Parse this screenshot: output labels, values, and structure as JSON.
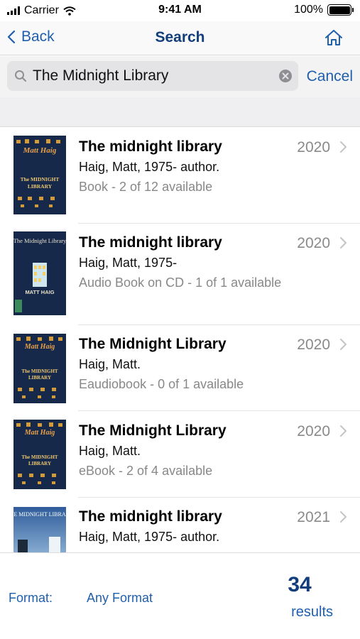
{
  "status_bar": {
    "carrier": "Carrier",
    "time": "9:41 AM",
    "battery": "100%"
  },
  "nav": {
    "back_label": "Back",
    "title": "Search"
  },
  "search": {
    "query": "The Midnight Library",
    "cancel_label": "Cancel"
  },
  "results": [
    {
      "title": "The midnight library",
      "author": "Haig, Matt, 1975- author.",
      "format": "Book - 2 of 12 available",
      "year": "2020",
      "cover": "dark"
    },
    {
      "title": "The midnight library",
      "author": "Haig, Matt, 1975-",
      "format": "Audio Book on CD - 1 of 1 available",
      "year": "2020",
      "cover": "cd"
    },
    {
      "title": "The Midnight Library",
      "author": "Haig, Matt.",
      "format": "Eaudiobook - 0 of 1 available",
      "year": "2020",
      "cover": "dark"
    },
    {
      "title": "The Midnight Library",
      "author": "Haig, Matt.",
      "format": "eBook - 2 of 4 available",
      "year": "2020",
      "cover": "dark"
    },
    {
      "title": "The midnight library",
      "author": "Haig, Matt, 1975- author.",
      "format": "",
      "year": "2021",
      "cover": "blue"
    }
  ],
  "footer": {
    "format_label": "Format:",
    "format_value": "Any Format",
    "count": "34",
    "count_label": "results"
  },
  "colors": {
    "accent": "#1f5fae",
    "title_blue": "#123e7c",
    "cover_navy": "#16294a"
  },
  "cover_text": {
    "author": "Matt Haig",
    "title_line1": "The MIDNIGHT",
    "title_line2": "LIBRARY",
    "cd_title": "The Midnight Library",
    "cd_author": "MATT HAIG",
    "blue_title": "THE MIDNIGHT LIBRARY"
  },
  "icons": {
    "back": "chevron-left-icon",
    "home": "home-icon",
    "search": "magnifier-icon",
    "clear": "clear-circle-icon",
    "row": "chevron-right-icon"
  }
}
